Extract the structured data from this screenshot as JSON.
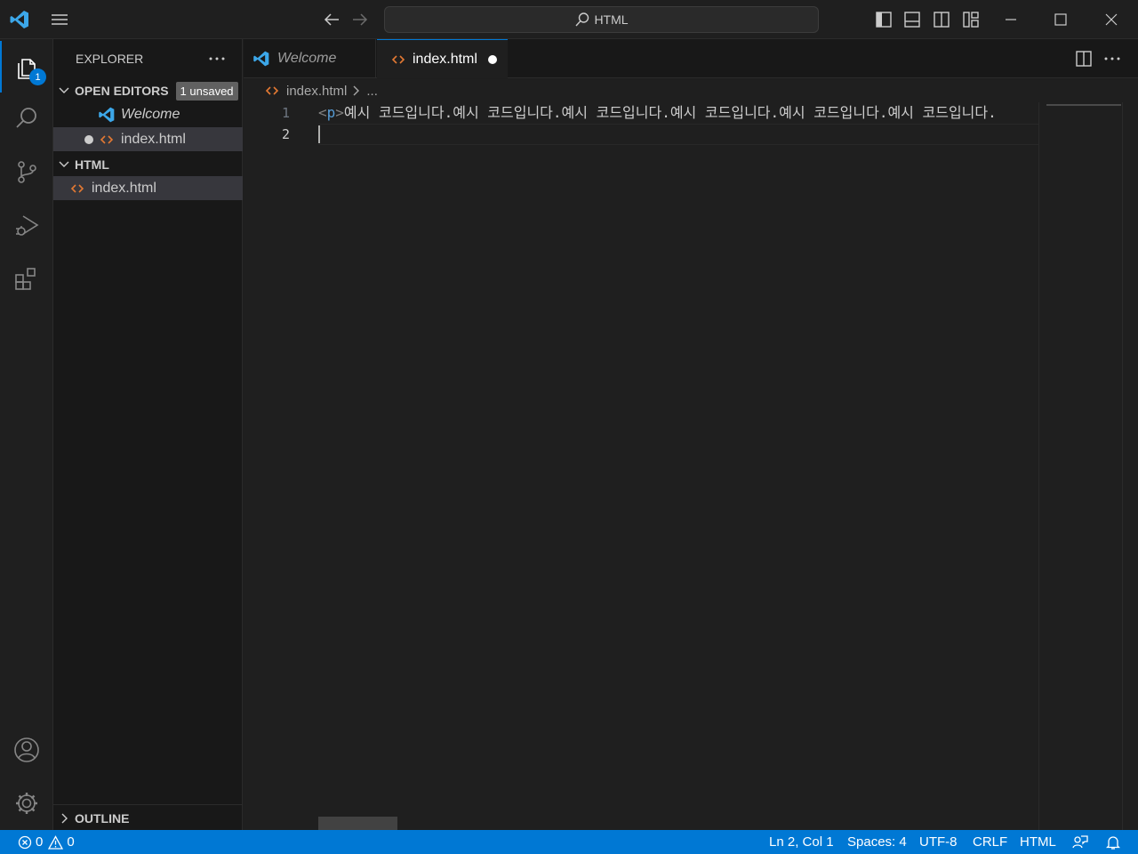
{
  "titlebar": {
    "command_center": "HTML"
  },
  "activity": {
    "explorer_badge": "1"
  },
  "sidebar": {
    "title": "EXPLORER",
    "open_editors": {
      "label": "OPEN EDITORS",
      "badge": "1 unsaved",
      "items": [
        {
          "label": "Welcome"
        },
        {
          "label": "index.html"
        }
      ]
    },
    "folder": {
      "label": "HTML",
      "items": [
        {
          "label": "index.html"
        }
      ]
    },
    "outline": "OUTLINE"
  },
  "tabs": [
    {
      "label": "Welcome"
    },
    {
      "label": "index.html"
    }
  ],
  "breadcrumb": {
    "file": "index.html",
    "more": "..."
  },
  "editor": {
    "lines": [
      {
        "number": "1",
        "tag_open": "<",
        "tag_name": "p",
        "tag_close": ">",
        "text": "예시 코드입니다.예시 코드입니다.예시 코드입니다.예시 코드입니다.예시 코드입니다.예시 코드입니다."
      },
      {
        "number": "2",
        "text": ""
      }
    ]
  },
  "status": {
    "errors": "0",
    "warnings": "0",
    "position": "Ln 2, Col 1",
    "spaces": "Spaces: 4",
    "encoding": "UTF-8",
    "eol": "CRLF",
    "language": "HTML"
  },
  "colors": {
    "accent": "#0078d4",
    "html_icon": "#e37933",
    "vscode_logo": "#3ca7e9"
  }
}
